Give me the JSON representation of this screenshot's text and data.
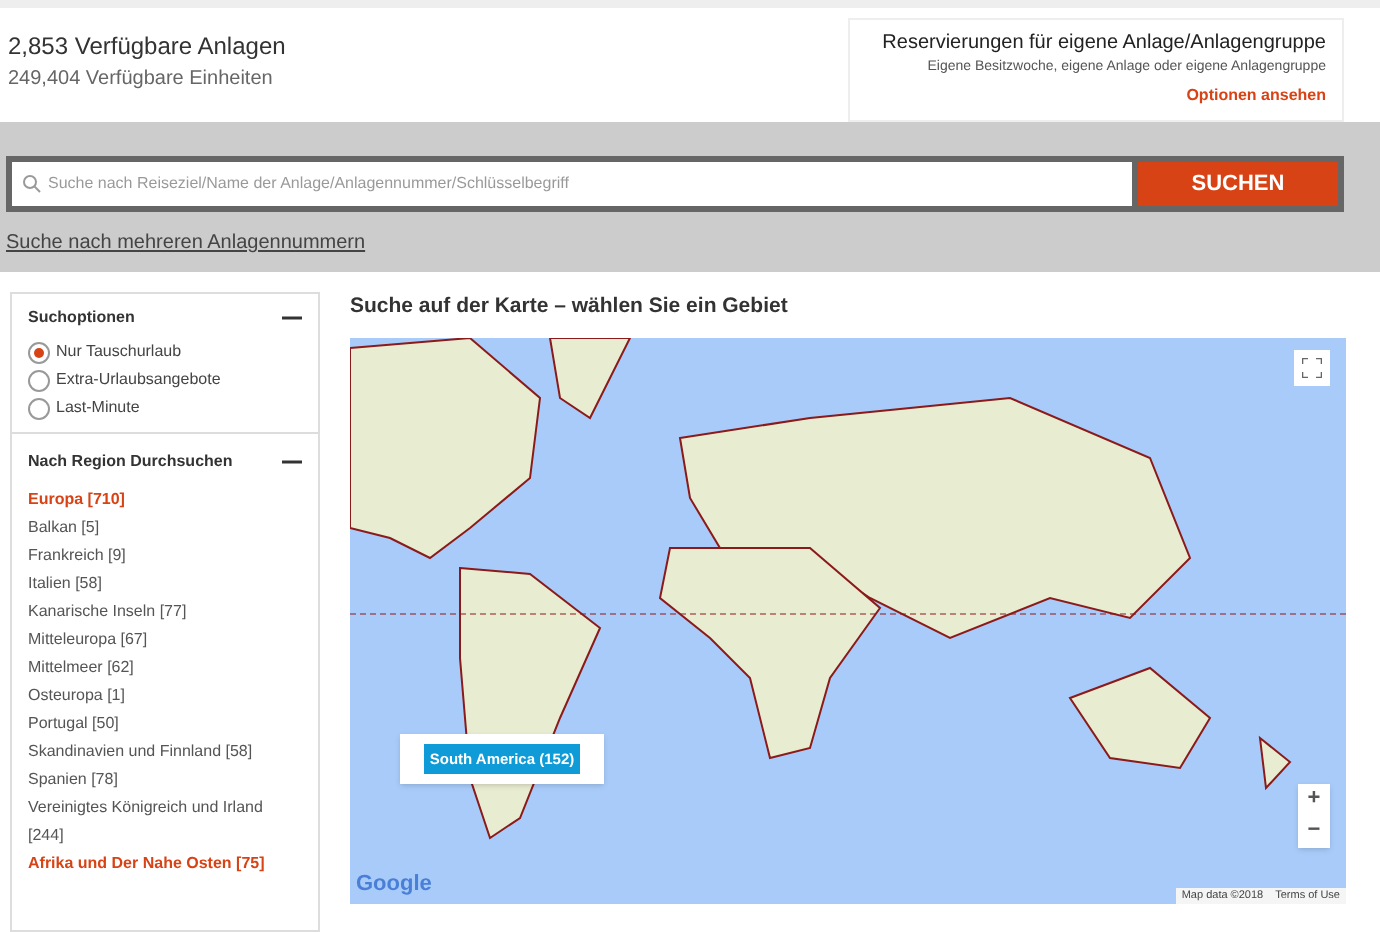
{
  "summary": {
    "title": "2,853 Verfügbare Anlagen",
    "subtitle": "249,404 Verfügbare Einheiten"
  },
  "reservation": {
    "title": "Reservierungen für eigene Anlage/Anlagengruppe",
    "subtitle": "Eigene Besitzwoche, eigene Anlage oder eigene Anlagengruppe",
    "link": "Optionen ansehen"
  },
  "search": {
    "placeholder": "Suche nach Reiseziel/Name der Anlage/Anlagennummer/Schlüsselbegriff",
    "button": "SUCHEN",
    "multi_link": "Suche nach mehreren Anlagennummern"
  },
  "search_options": {
    "title": "Suchoptionen",
    "expanded": true,
    "options": [
      {
        "label": "Nur Tauschurlaub",
        "selected": true
      },
      {
        "label": "Extra-Urlaubsangebote",
        "selected": false
      },
      {
        "label": "Last-Minute",
        "selected": false
      }
    ]
  },
  "regions": {
    "title": "Nach Region Durchsuchen",
    "expanded": true,
    "items": [
      {
        "kind": "group",
        "label": "Europa [710]"
      },
      {
        "kind": "item",
        "label": "Balkan [5]"
      },
      {
        "kind": "item",
        "label": "Frankreich [9]"
      },
      {
        "kind": "item",
        "label": "Italien [58]"
      },
      {
        "kind": "item",
        "label": "Kanarische Inseln [77]"
      },
      {
        "kind": "item",
        "label": "Mitteleuropa [67]"
      },
      {
        "kind": "item",
        "label": "Mittelmeer [62]"
      },
      {
        "kind": "item",
        "label": "Osteuropa [1]"
      },
      {
        "kind": "item",
        "label": "Portugal [50]"
      },
      {
        "kind": "item",
        "label": "Skandinavien und Finnland [58]"
      },
      {
        "kind": "item",
        "label": "Spanien [78]"
      },
      {
        "kind": "item",
        "label": "Vereinigtes Königreich und Irland [244]"
      },
      {
        "kind": "group",
        "label": "Afrika und Der Nahe Osten [75]"
      }
    ]
  },
  "map": {
    "title": "Suche auf der Karte – wählen Sie ein Gebiet",
    "popup": "South America (152)",
    "logo": "Google",
    "attribution": "Map data ©2018",
    "terms": "Terms of Use",
    "zoom_in": "+",
    "zoom_out": "−"
  }
}
